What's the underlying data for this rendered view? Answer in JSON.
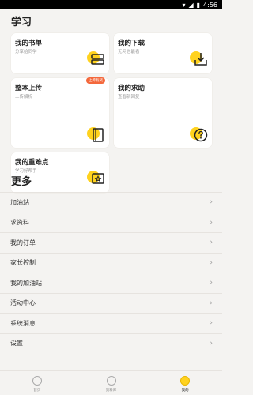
{
  "status_bar": {
    "time": "4:56"
  },
  "study": {
    "title": "学习",
    "cards": [
      {
        "title": "我的书单",
        "subtitle": "分享给同学"
      },
      {
        "title": "我的下载",
        "subtitle": "无网也能看"
      },
      {
        "title": "整本上传",
        "subtitle": "上传解析",
        "badge": "上传有奖"
      },
      {
        "title": "我的求助",
        "subtitle": "查看新回复"
      },
      {
        "title": "我的重难点",
        "subtitle": "学习好帮手"
      }
    ]
  },
  "more": {
    "title": "更多",
    "items": [
      "加油站",
      "求资料",
      "我的订单",
      "家长控制",
      "我的加油站",
      "活动中心",
      "系统消息",
      "设置"
    ]
  },
  "tabs": [
    {
      "label": "首页",
      "icon": "home-icon"
    },
    {
      "label": "资料库",
      "icon": "library-icon"
    },
    {
      "label": "我的",
      "icon": "profile-icon",
      "active": true
    }
  ],
  "colors": {
    "accent": "#ffd21e",
    "badge": "#f4683c",
    "background": "#f4f3f1"
  }
}
